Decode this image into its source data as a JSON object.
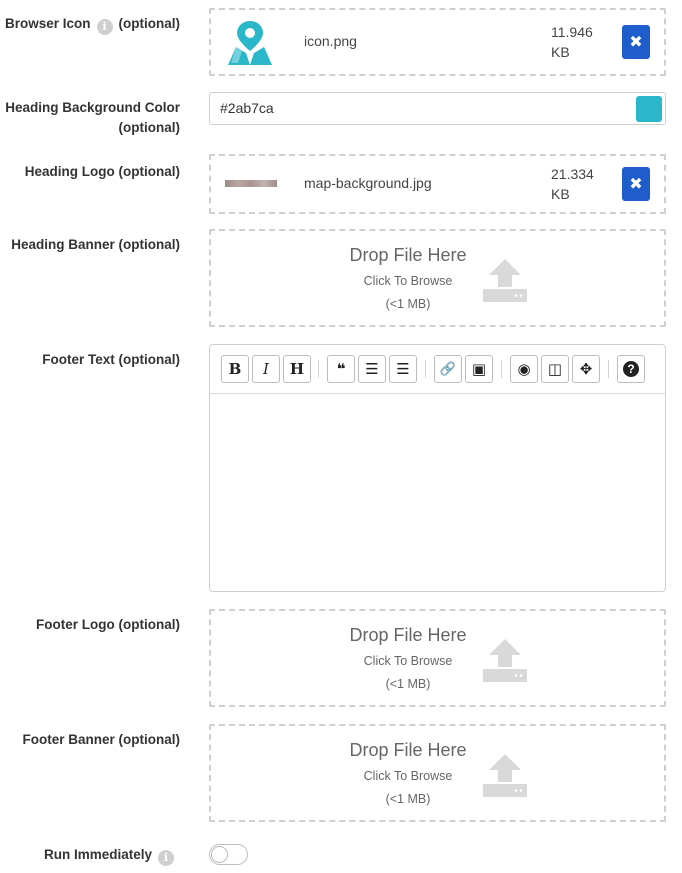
{
  "browser_icon": {
    "label": "Browser Icon",
    "optional": "(optional)",
    "info": "i",
    "file_name": "icon.png",
    "file_size_value": "11.946",
    "file_size_unit": "KB",
    "remove": "✖"
  },
  "heading_bg_color": {
    "label_line1": "Heading Background Color",
    "label_line2": "(optional)",
    "value": "#2ab7ca",
    "swatch_color": "#2ab7ca"
  },
  "heading_logo": {
    "label": "Heading Logo (optional)",
    "file_name": "map-background.jpg",
    "file_size_value": "21.334",
    "file_size_unit": "KB",
    "remove": "✖"
  },
  "heading_banner": {
    "label": "Heading Banner (optional)",
    "drop_title": "Drop File Here",
    "drop_browse": "Click To Browse",
    "drop_limit": "(<1 MB)"
  },
  "footer_text": {
    "label": "Footer Text (optional)",
    "toolbar": {
      "bold": "B",
      "italic": "I",
      "heading": "H",
      "quote": "❝",
      "ul": "☰",
      "ol": "☰",
      "link": "🔗",
      "image": "▣",
      "preview": "◉",
      "side_by_side": "◫",
      "fullscreen": "✥",
      "guide": "?"
    }
  },
  "footer_logo": {
    "label": "Footer Logo (optional)",
    "drop_title": "Drop File Here",
    "drop_browse": "Click To Browse",
    "drop_limit": "(<1 MB)"
  },
  "footer_banner": {
    "label": "Footer Banner (optional)",
    "drop_title": "Drop File Here",
    "drop_browse": "Click To Browse",
    "drop_limit": "(<1 MB)"
  },
  "run_immediately": {
    "label": "Run Immediately",
    "info": "i",
    "enabled": false
  },
  "colors": {
    "accent": "#2ab7ca",
    "button_blue": "#1f5dcc",
    "dashed_border": "#cfcfcf"
  }
}
